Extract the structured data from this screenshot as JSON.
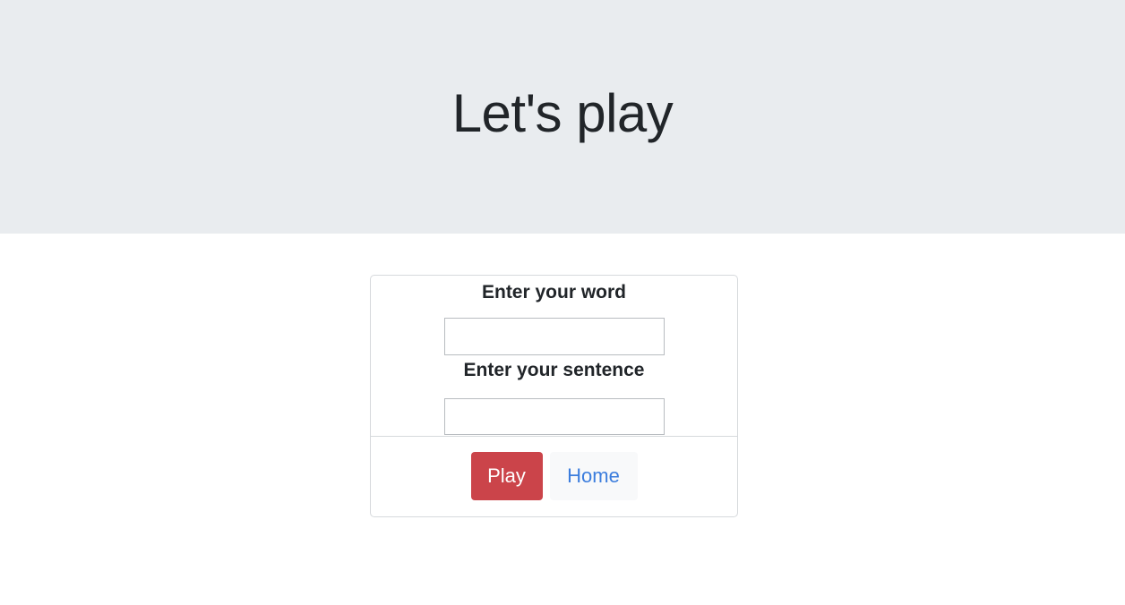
{
  "header": {
    "title": "Let's play"
  },
  "form": {
    "word_label": "Enter your word",
    "word_value": "",
    "sentence_label": "Enter your sentence",
    "sentence_value": ""
  },
  "footer": {
    "play_label": "Play",
    "home_label": "Home"
  },
  "colors": {
    "jumbotron_bg": "#e9ecef",
    "play_button_bg": "#cb444a",
    "home_link_color": "#3b7ddd"
  }
}
